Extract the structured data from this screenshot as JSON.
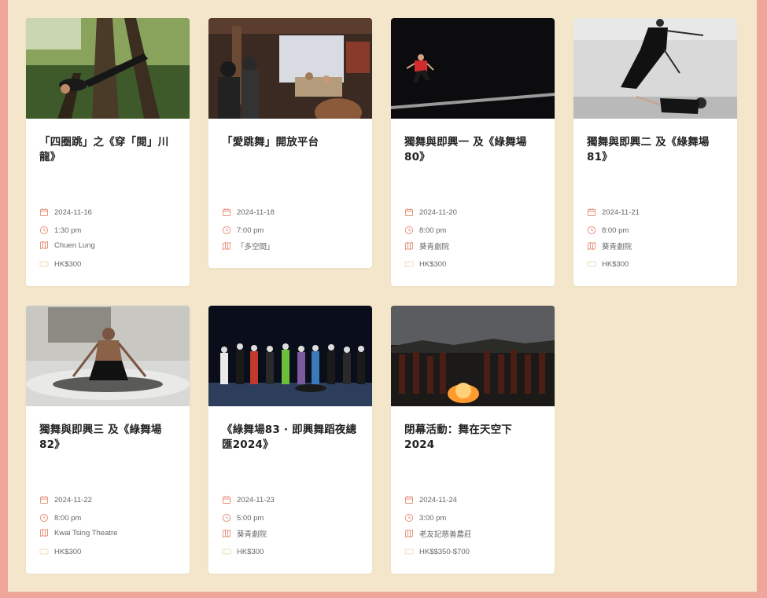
{
  "colors": {
    "page_border": "#f0a59b",
    "page_bg": "#f3e6cb",
    "card_bg": "#ffffff",
    "icon_accent": "#e8957f"
  },
  "events": [
    {
      "title": "「四圈跳」之《穿「閱」川龍》",
      "date": "2024-11-16",
      "time": "1:30 pm",
      "venue": "Chuen Lung",
      "price": "HK$300"
    },
    {
      "title": "「愛跳舞」開放平台",
      "date": "2024-11-18",
      "time": "7:00 pm",
      "venue": "「多空間」",
      "price": ""
    },
    {
      "title": "獨舞與即興一 及《綠舞場80》",
      "date": "2024-11-20",
      "time": "8:00 pm",
      "venue": "葵青劇院",
      "price": "HK$300"
    },
    {
      "title": "獨舞與即興二 及《綠舞場81》",
      "date": "2024-11-21",
      "time": "8:00 pm",
      "venue": "葵青劇院",
      "price": "HK$300"
    },
    {
      "title": "獨舞與即興三 及《綠舞場82》",
      "date": "2024-11-22",
      "time": "8:00 pm",
      "venue": "Kwai Tsing Theatre",
      "price": "HK$300"
    },
    {
      "title": "《綠舞場83 · 即興舞蹈夜總匯2024》",
      "date": "2024-11-23",
      "time": "5:00 pm",
      "venue": "葵青劇院",
      "price": "HK$300"
    },
    {
      "title": "閉幕活動：舞在天空下 2024",
      "date": "2024-11-24",
      "time": "3:00 pm",
      "venue": "老友記慈善農莊",
      "price": "HK$$350-$700"
    }
  ]
}
